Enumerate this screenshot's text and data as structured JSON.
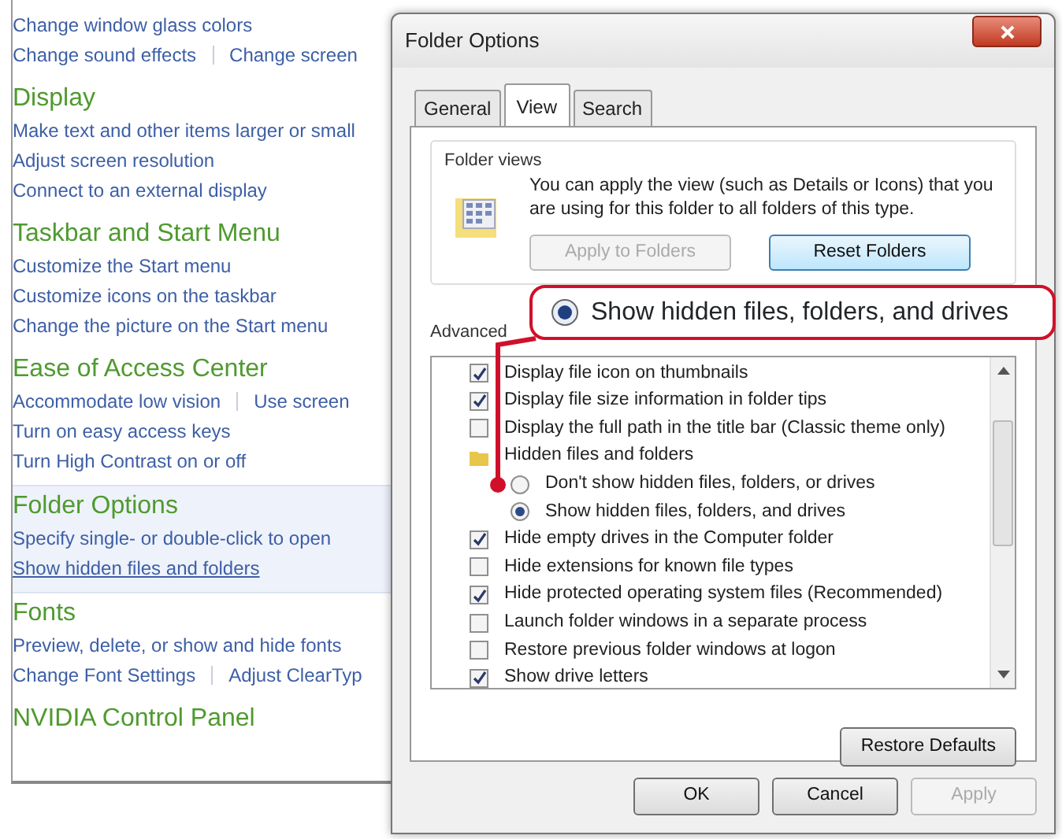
{
  "control_panel": {
    "sections": [
      {
        "selected": false,
        "rows": [
          [
            {
              "text": "Change window glass colors",
              "hovered": false
            }
          ],
          [
            {
              "text": "Change sound effects",
              "hovered": false
            },
            {
              "text": "Change screen",
              "hovered": false
            }
          ]
        ]
      },
      {
        "title": "Display",
        "selected": false,
        "rows": [
          [
            {
              "text": "Make text and other items larger or small",
              "hovered": false
            }
          ],
          [
            {
              "text": "Adjust screen resolution",
              "hovered": false
            }
          ],
          [
            {
              "text": "Connect to an external display",
              "hovered": false
            }
          ]
        ]
      },
      {
        "title": "Taskbar and Start Menu",
        "selected": false,
        "rows": [
          [
            {
              "text": "Customize the Start menu",
              "hovered": false
            }
          ],
          [
            {
              "text": "Customize icons on the taskbar",
              "hovered": false
            }
          ],
          [
            {
              "text": "Change the picture on the Start menu",
              "hovered": false
            }
          ]
        ]
      },
      {
        "title": "Ease of Access Center",
        "selected": false,
        "rows": [
          [
            {
              "text": "Accommodate low vision",
              "hovered": false
            },
            {
              "text": "Use screen",
              "hovered": false
            }
          ],
          [
            {
              "text": "Turn on easy access keys",
              "hovered": false
            }
          ],
          [
            {
              "text": "Turn High Contrast on or off",
              "hovered": false
            }
          ]
        ]
      },
      {
        "title": "Folder Options",
        "selected": true,
        "rows": [
          [
            {
              "text": "Specify single- or double-click to open",
              "hovered": false
            }
          ],
          [
            {
              "text": "Show hidden files and folders",
              "hovered": true
            }
          ]
        ]
      },
      {
        "title": "Fonts",
        "selected": false,
        "rows": [
          [
            {
              "text": "Preview, delete, or show and hide fonts",
              "hovered": false
            }
          ],
          [
            {
              "text": "Change Font Settings",
              "hovered": false
            },
            {
              "text": "Adjust ClearTyp",
              "hovered": false
            }
          ]
        ]
      },
      {
        "title": "NVIDIA Control Panel",
        "selected": false
      }
    ]
  },
  "dialog": {
    "title": "Folder Options",
    "tabs": [
      {
        "label": "General",
        "selected": false
      },
      {
        "label": "View",
        "selected": true
      },
      {
        "label": "Search",
        "selected": false
      }
    ],
    "folder_views": {
      "label": "Folder views",
      "description": "You can apply the view (such as Details or Icons) that you are using for this folder to all folders of this type.",
      "buttons": [
        {
          "label": "Apply to Folders",
          "disabled": true
        },
        {
          "label": "Reset Folders",
          "disabled": false
        }
      ]
    },
    "advanced": {
      "label": "Advanced",
      "items": [
        {
          "kind": "checkbox",
          "text": "Display file icon on thumbnails",
          "checked": true
        },
        {
          "kind": "checkbox",
          "text": "Display file size information in folder tips",
          "checked": true
        },
        {
          "kind": "checkbox",
          "text": "Display the full path in the title bar (Classic theme only)",
          "checked": false
        },
        {
          "kind": "folder",
          "text": "Hidden files and folders",
          "children": [
            {
              "kind": "radio",
              "text": "Don't show hidden files, folders, or drives",
              "selected": false
            },
            {
              "kind": "radio",
              "text": "Show hidden files, folders, and drives",
              "selected": true
            }
          ]
        },
        {
          "kind": "checkbox",
          "text": "Hide empty drives in the Computer folder",
          "checked": true
        },
        {
          "kind": "checkbox",
          "text": "Hide extensions for known file types",
          "checked": false
        },
        {
          "kind": "checkbox",
          "text": "Hide protected operating system files (Recommended)",
          "checked": true
        },
        {
          "kind": "checkbox",
          "text": "Launch folder windows in a separate process",
          "checked": false
        },
        {
          "kind": "checkbox",
          "text": "Restore previous folder windows at logon",
          "checked": false
        },
        {
          "kind": "checkbox",
          "text": "Show drive letters",
          "checked": true
        }
      ]
    },
    "restore_button": "Restore Defaults",
    "buttons": [
      {
        "label": "OK",
        "disabled": false
      },
      {
        "label": "Cancel",
        "disabled": false
      },
      {
        "label": "Apply",
        "disabled": true
      }
    ]
  },
  "callout": {
    "text": "Show hidden files, folders, and drives",
    "selected": true
  }
}
